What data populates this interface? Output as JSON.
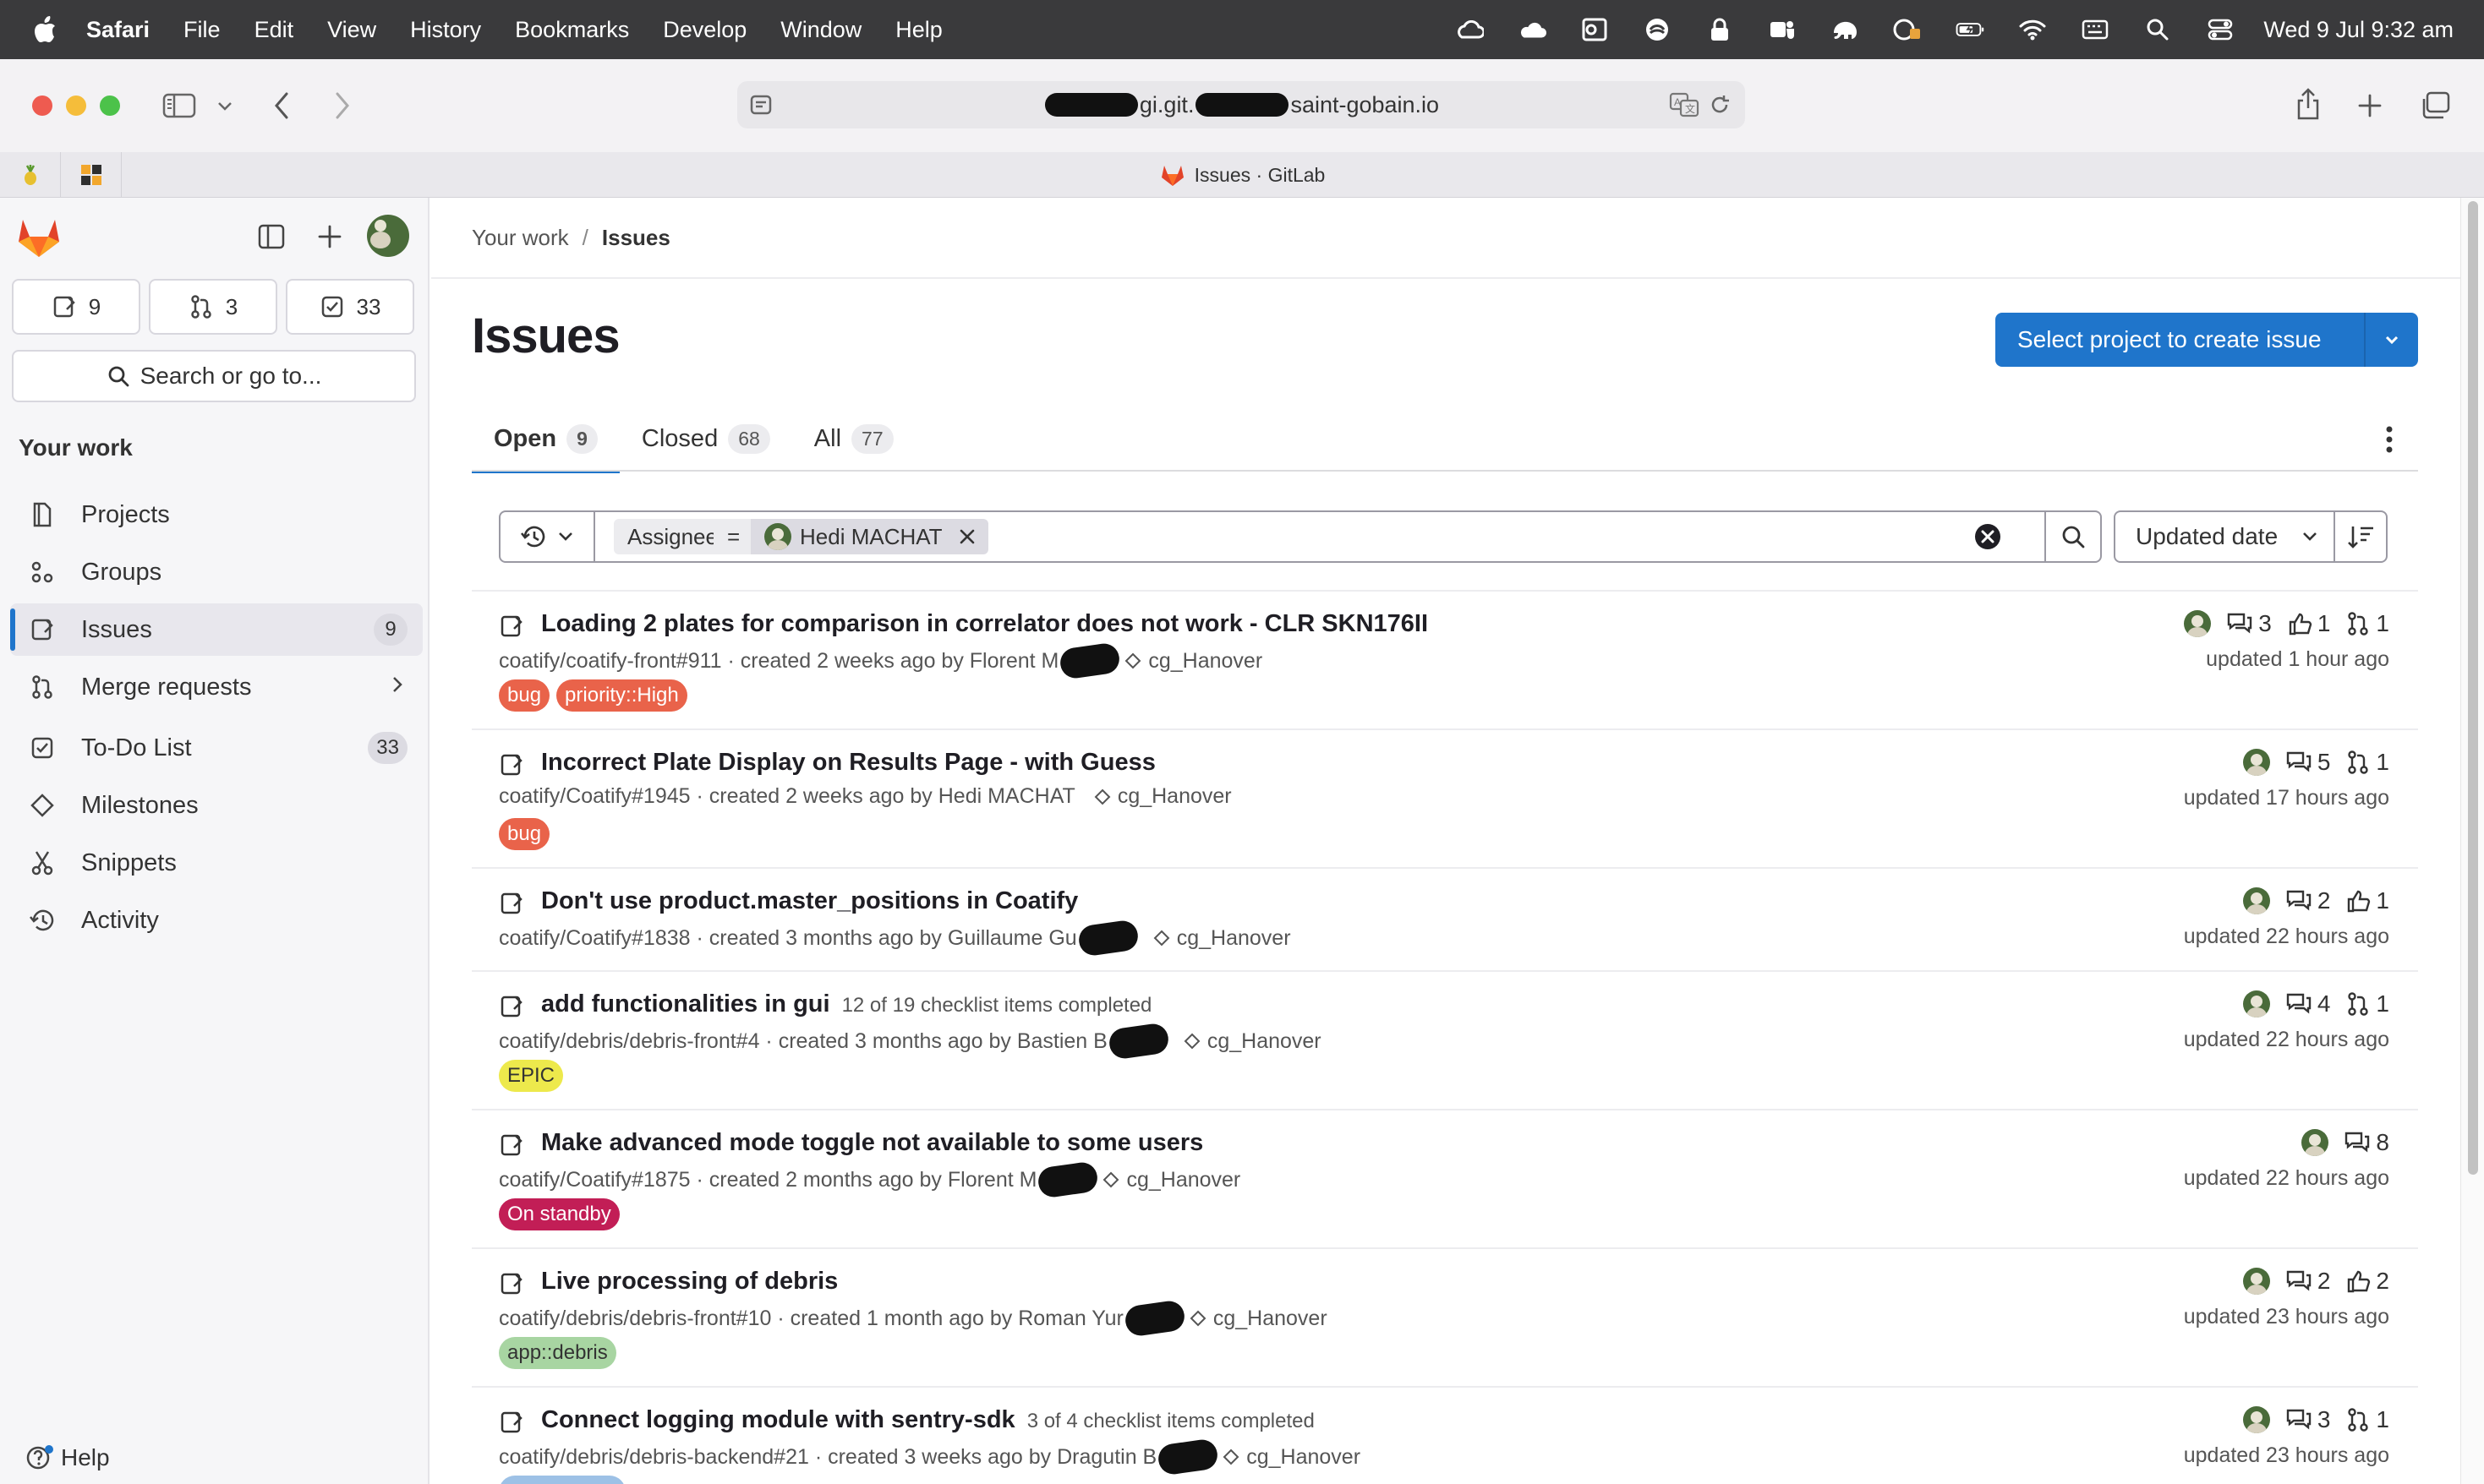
{
  "menubar": {
    "app": "Safari",
    "items": [
      "File",
      "Edit",
      "View",
      "History",
      "Bookmarks",
      "Develop",
      "Window",
      "Help"
    ],
    "clock": "Wed 9 Jul  9:32 am"
  },
  "browser": {
    "url_part1": "gi.git.",
    "url_part2": "saint-gobain.io",
    "tab_title": "Issues · GitLab"
  },
  "sidebar": {
    "counts": {
      "issues": "9",
      "merge_requests": "3",
      "todos": "33"
    },
    "search_label": "Search or go to...",
    "section_title": "Your work",
    "items": [
      {
        "label": "Projects"
      },
      {
        "label": "Groups"
      },
      {
        "label": "Issues",
        "badge": "9"
      },
      {
        "label": "Merge requests"
      },
      {
        "label": "To-Do List",
        "badge": "33"
      },
      {
        "label": "Milestones"
      },
      {
        "label": "Snippets"
      },
      {
        "label": "Activity"
      }
    ],
    "help": "Help"
  },
  "main": {
    "breadcrumb": {
      "root": "Your work",
      "current": "Issues"
    },
    "title": "Issues",
    "create_button": "Select project to create issue",
    "tabs": [
      {
        "label": "Open",
        "count": "9"
      },
      {
        "label": "Closed",
        "count": "68"
      },
      {
        "label": "All",
        "count": "77"
      }
    ],
    "filter": {
      "field": "Assignee",
      "operator": "=",
      "value": "Hedi MACHAT"
    },
    "sort_label": "Updated date"
  },
  "issues": [
    {
      "title": "Loading 2 plates for comparison in correlator does not work - CLR SKN176II",
      "ref": "coatify/coatify-front#911",
      "created": "created 2 weeks ago by Florent M",
      "milestone": "cg_Hanover",
      "labels": [
        {
          "text": "bug",
          "bg": "#e9634a",
          "fg": "#ffffff"
        },
        {
          "text": "priority::High",
          "bg": "#e9634a",
          "fg": "#ffffff"
        }
      ],
      "comments": "3",
      "upvotes": "1",
      "mrs": "1",
      "updated": "updated 1 hour ago"
    },
    {
      "title": "Incorrect Plate Display on Results Page - with Guess",
      "ref": "coatify/Coatify#1945",
      "created": "created 2 weeks ago by Hedi MACHAT",
      "milestone": "cg_Hanover",
      "labels": [
        {
          "text": "bug",
          "bg": "#e9634a",
          "fg": "#ffffff"
        }
      ],
      "comments": "5",
      "mrs": "1",
      "updated": "updated 17 hours ago"
    },
    {
      "title": "Don't use product.master_positions in Coatify",
      "ref": "coatify/Coatify#1838",
      "created": "created 3 months ago by Guillaume Gu",
      "milestone": "cg_Hanover",
      "labels": [],
      "comments": "2",
      "upvotes": "1",
      "updated": "updated 22 hours ago"
    },
    {
      "title": "add functionalities in gui",
      "checklist": "12 of 19 checklist items completed",
      "ref": "coatify/debris/debris-front#4",
      "created": "created 3 months ago by Bastien B",
      "milestone": "cg_Hanover",
      "labels": [
        {
          "text": "EPIC",
          "bg": "#ede94c",
          "fg": "#333333"
        }
      ],
      "comments": "4",
      "mrs": "1",
      "updated": "updated 22 hours ago"
    },
    {
      "title": "Make advanced mode toggle not available to some users",
      "ref": "coatify/Coatify#1875",
      "created": "created 2 months ago by Florent M",
      "milestone": "cg_Hanover",
      "labels": [
        {
          "text": "On standby",
          "bg": "#c21e56",
          "fg": "#ffffff"
        }
      ],
      "comments": "8",
      "updated": "updated 22 hours ago"
    },
    {
      "title": "Live processing of debris",
      "ref": "coatify/debris/debris-front#10",
      "created": "created 1 month ago by Roman Yur",
      "milestone": "cg_Hanover",
      "labels": [
        {
          "text": "app::debris",
          "bg": "#a8d5a2",
          "fg": "#333333"
        }
      ],
      "comments": "2",
      "upvotes": "2",
      "updated": "updated 23 hours ago"
    },
    {
      "title": "Connect logging module with sentry-sdk",
      "checklist": "3 of 4 checklist items completed",
      "ref": "coatify/debris/debris-backend#21",
      "created": "created 3 weeks ago by Dragutin B",
      "milestone": "cg_Hanover",
      "labels": [],
      "comments": "3",
      "mrs": "1",
      "updated": "updated 23 hours ago"
    }
  ]
}
